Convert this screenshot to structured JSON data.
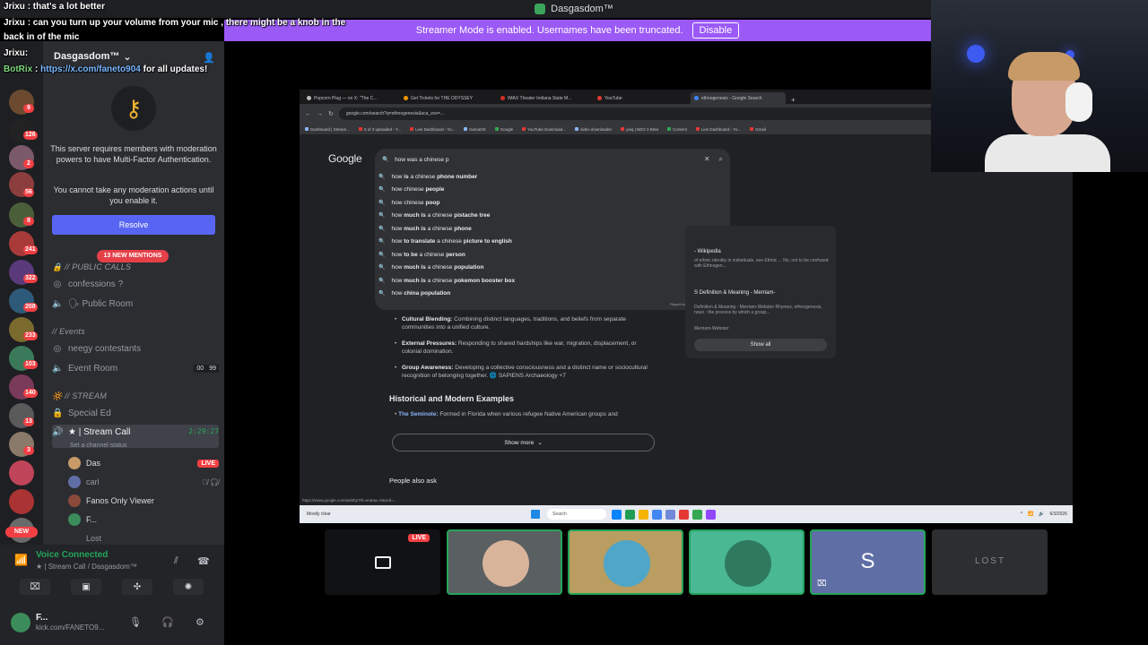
{
  "app": {
    "title": "Dasgasdom™"
  },
  "banner": {
    "text": "Streamer Mode is enabled. Usernames have been truncated.",
    "disable_label": "Disable"
  },
  "chat": [
    {
      "user": "Jrixu",
      "message": ": that's a lot better"
    },
    {
      "user": "Jrixu",
      "message": ": can you turn up your volume from your mic , there might be a knob in the"
    },
    {
      "user": "",
      "message": "back in of the mic"
    },
    {
      "user": "Jrixu",
      "message": ":"
    },
    {
      "user": "BotRix",
      "message": ":",
      "url": "https://x.com/faneto904",
      "after": "for all updates!"
    }
  ],
  "server": {
    "name": "Dasgasdom™",
    "mfa_line1": "This server requires members with moderation powers to have Multi-Factor Authentication.",
    "mfa_line2": "You cannot take any moderation actions until you enable it.",
    "resolve_label": "Resolve",
    "mentions_label": "13 NEW MENTIONS",
    "categories": [
      {
        "label": "// PUBLIC CALLS",
        "channels": [
          {
            "name": "confessions ?"
          },
          {
            "name": "🗣 Public Room"
          }
        ]
      },
      {
        "label": "// Events",
        "channels": [
          {
            "name": "neegy contestants"
          },
          {
            "name": "Event Room",
            "count_a": "00",
            "count_b": "99"
          }
        ]
      },
      {
        "label": "// STREAM",
        "channels": [
          {
            "name": "Special Ed"
          },
          {
            "name": "★ | Stream Call",
            "timer": "2:29:27",
            "status": "Set a channel status"
          }
        ]
      }
    ],
    "voice_users": [
      {
        "name": "Das",
        "badge": "LIVE"
      },
      {
        "name": "carl"
      },
      {
        "name": "Fanos Only Viewer"
      },
      {
        "name": "F..."
      },
      {
        "name": "Lost"
      }
    ]
  },
  "rail": {
    "badges": [
      "9",
      "126",
      "2",
      "56",
      "8",
      "241",
      "322",
      "208",
      "233",
      "103",
      "140",
      "13",
      "3"
    ],
    "new_label": "NEW"
  },
  "user_panel": {
    "voice_connected": "Voice Connected",
    "voice_sub": "★ | Stream Call / Dasgasdom™",
    "name": "F...",
    "status": "kick.com/FANETO9..."
  },
  "browser": {
    "tabs": [
      "Popcorn Plug — on X: \"The C...",
      "Get Tickets for THE ODYSSEY",
      "IMAX Theater Indiana State M...",
      "YouTube",
      "ethnogenesis - Google Search"
    ],
    "url": "google.com/search?q=ethnogenesis&sca_esv=...",
    "bookmarks": [
      "Dashboard | Stream...",
      "5 of 3 uploaded - Y...",
      "Live Dashboard - Yo...",
      "KamaOS",
      "Google",
      "YouTube Download...",
      "video downloader",
      "yaiq | NEO 3 Beta",
      "Content",
      "Live Dashboard - Yo...",
      "Gmail"
    ],
    "google": "Google",
    "query": "how was a chinese p",
    "suggestions": [
      {
        "pre": "how ",
        "bold": "is",
        "mid": " a chinese ",
        "bold2": "phone number"
      },
      {
        "pre": "how chinese ",
        "bold": "people",
        "mid": "",
        "bold2": ""
      },
      {
        "pre": "how chinese ",
        "bold": "poop",
        "mid": "",
        "bold2": ""
      },
      {
        "pre": "how ",
        "bold": "much is",
        "mid": " a chinese ",
        "bold2": "pistache tree"
      },
      {
        "pre": "how ",
        "bold": "much is",
        "mid": " a chinese ",
        "bold2": "phone"
      },
      {
        "pre": "how ",
        "bold": "to translate",
        "mid": " a chinese ",
        "bold2": "picture to english"
      },
      {
        "pre": "how ",
        "bold": "to be",
        "mid": " a chinese ",
        "bold2": "person"
      },
      {
        "pre": "how ",
        "bold": "much is",
        "mid": " a chinese ",
        "bold2": "population"
      },
      {
        "pre": "how ",
        "bold": "much is",
        "mid": " a chinese ",
        "bold2": "pokemon booster box"
      },
      {
        "pre": "how ",
        "bold": "china",
        "mid": " ",
        "bold2": "population"
      }
    ],
    "report_label": "Report inappropriate predictions",
    "bullets": [
      {
        "title": "Cultural Blending:",
        "text": " Combining distinct languages, traditions, and beliefs from separate communities into a unified culture."
      },
      {
        "title": "External Pressures:",
        "text": " Responding to shared hardships like war, migration, displacement, or colonial domination."
      },
      {
        "title": "Group Awareness:",
        "text": " Developing a collective consciousness and a distinct name or sociocultural recognition of belonging together. 🌐 SAPIENS Archaeology +7"
      }
    ],
    "hist_heading": "Historical and Modern Examples",
    "seminole_title": "The Seminole:",
    "seminole_text": " Formed in Florida when various refugee Native American groups and",
    "show_more": "Show more",
    "people_ask": "People also ask",
    "side_panel": {
      "wiki_title": "- Wikipedia",
      "wiki_text": "of ethnic identity in individuals, see Ethnic ... No, not to be confused with Ethnogen...",
      "mw_title": "S Definition & Meaning - Merriam-",
      "mw_text": "Definition & Meaning - Merriam-Webster Rhymes, ethnogenesis, noun : the process by which a group...",
      "mw_source": "Merriam-Webster",
      "show_all": "Show all"
    },
    "status_url": "https://www.google.com/webhp?hl=en&sa=X&ved=...",
    "taskbar": {
      "weather": "Mostly clear",
      "search": "Search",
      "date": "6/3/2026"
    }
  },
  "tiles": {
    "live_label": "LIVE",
    "tile4_letter": "S",
    "tile5_text": "LOST"
  }
}
